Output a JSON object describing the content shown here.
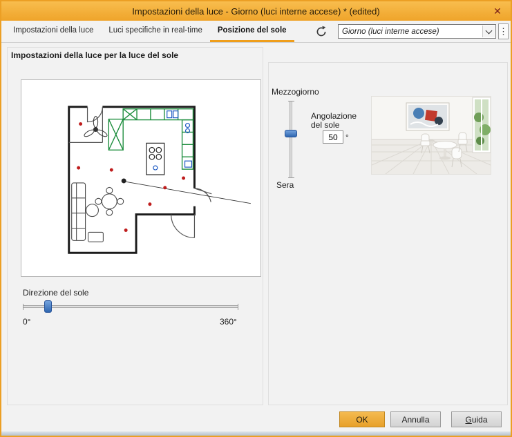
{
  "window": {
    "title": "Impostazioni della luce - Giorno (luci interne accese) * (edited)"
  },
  "icons": {
    "close": "✕",
    "menu_dots": "⋮"
  },
  "tabs": [
    {
      "label": "Impostazioni della luce",
      "active": false
    },
    {
      "label": "Luci specifiche in real-time",
      "active": false
    },
    {
      "label": "Posizione del sole",
      "active": true
    }
  ],
  "preset": {
    "value": "Giorno (luci interne accese)"
  },
  "sun_panel": {
    "header": "Impostazioni della luce per la luce del sole",
    "direction_label": "Direzione del sole",
    "direction_min": "0°",
    "direction_max": "360°"
  },
  "elevation_panel": {
    "top_label": "Mezzogiorno",
    "bottom_label": "Sera",
    "angle_label_line1": "Angolazione",
    "angle_label_line2": "del sole",
    "angle_value": "50",
    "degree": "°"
  },
  "footer": {
    "ok": "OK",
    "cancel": "Annulla",
    "help_key": "G",
    "help_rest": "uida"
  },
  "colors": {
    "accent": "#EF9E1B",
    "titlebar": "#F2AC38",
    "slider_thumb": "#3D78C8",
    "ok_button": "#E8A535"
  }
}
